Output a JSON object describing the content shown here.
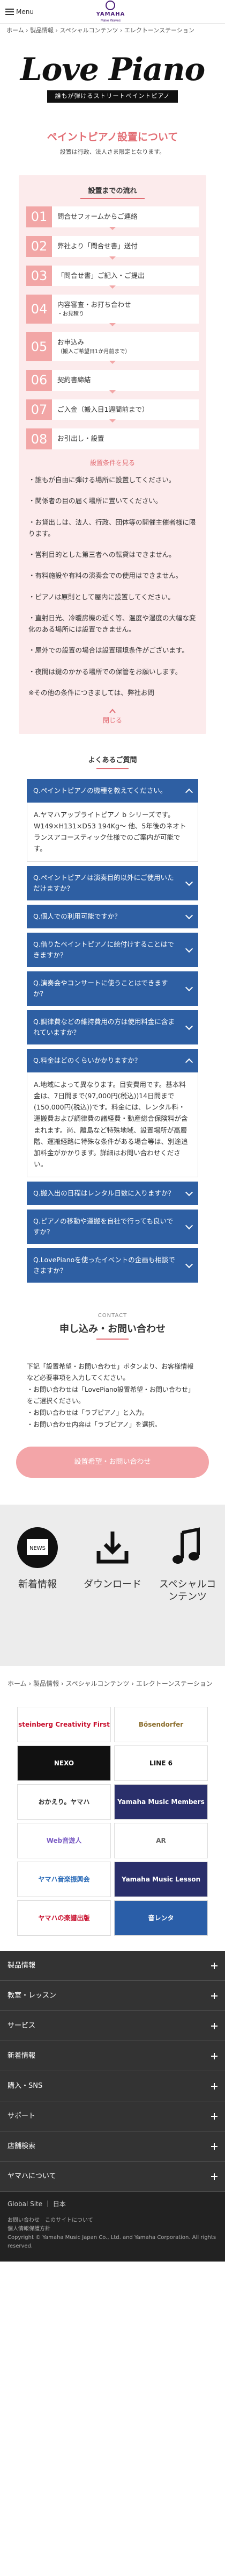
{
  "header": {
    "menu_label": "Menu",
    "brand": "YAMAHA",
    "brand_sub": "Make Waves"
  },
  "breadcrumb": {
    "text": "ホーム › 製品情報 › スペシャルコンテンツ › エレクトーンステーション"
  },
  "hero": {
    "title": "Love Piano",
    "tag": "誰もが弾けるストリートペイントピアノ"
  },
  "section": {
    "title": "ペイントピアノ設置について",
    "sub": "設置は行政、法人さま限定となります。"
  },
  "flow": {
    "heading": "設置までの流れ",
    "steps": [
      {
        "no": "01",
        "text": "問合せフォームからご連絡",
        "note": ""
      },
      {
        "no": "02",
        "text": "弊社より「問合せ書」送付",
        "note": ""
      },
      {
        "no": "03",
        "text": "「問合せ書」ご記入・ご提出",
        "note": ""
      },
      {
        "no": "04",
        "text": "内容審査・お打ち合わせ",
        "note": "・お見積り"
      },
      {
        "no": "05",
        "text": "お申込み",
        "note": "（搬入ご希望日1か月前まで）"
      },
      {
        "no": "06",
        "text": "契約書締結",
        "note": ""
      },
      {
        "no": "07",
        "text": "ご入金（搬入日1週間前まで）",
        "note": ""
      },
      {
        "no": "08",
        "text": "お引出し・設置",
        "note": ""
      }
    ],
    "cond_link": "設置条件を見る",
    "conditions": [
      "・誰もが自由に弾ける場所に設置してください。",
      "・関係者の目の届く場所に置いてください。",
      "・お貸出しは、法人、行政、団体等の開催主催者様に限ります。",
      "・営利目的とした第三者への転貸はできません。",
      "・有料施設や有料の演奏会での使用はできません。",
      "・ピアノは原則として屋内に設置してください。",
      "・直射日光、冷暖房機の近く等、温度や湿度の大幅な変化のある場所には設置できません。",
      "・屋外での設置の場合は設置環境条件がございます。",
      "・夜間は鍵のかかる場所での保管をお願いします。",
      "※その他の条件につきましては、弊社お問"
    ],
    "close_link": "閉じる"
  },
  "faq": {
    "title": "よくあるご質問",
    "items": [
      {
        "q": "Q.ペイントピアノの機種を教えてください。",
        "open": true,
        "a": "A.ヤマハアップライトピアノ b シリーズです。W149×H131×D53 194Kg〜 他、5年後のネオトランスアコースティック仕様でのご案内が可能です。"
      },
      {
        "q": "Q.ペイントピアノは演奏目的以外にご使用いただけますか？",
        "open": false,
        "a": ""
      },
      {
        "q": "Q.個人での利用可能ですか？",
        "open": false,
        "a": ""
      },
      {
        "q": "Q.借りたペイントピアノに絵付けすることはできますか？",
        "open": false,
        "a": ""
      },
      {
        "q": "Q.演奏会やコンサートに使うことはできますか？",
        "open": false,
        "a": ""
      },
      {
        "q": "Q.調律費などの維持費用の方は使用料金に含まれていますか？",
        "open": false,
        "a": ""
      },
      {
        "q": "Q.料金はどのくらいかかりますか？",
        "open": true,
        "a": "A.地域によって異なります。目安費用です。基本料金は、7日間まで(97,000円(税込))14日間まで(150,000円(税込))です。料金には、レンタル料・運搬費および調律費の諸経費・動産総合保険料が含まれます。尚、離島など特殊地域、設置場所が高層階、運搬経路に特殊な条件がある場合等は、別途追加料金がかかります。詳細はお問い合わせください。"
      },
      {
        "q": "Q.搬入出の日程はレンタル日数に入りますか？",
        "open": false,
        "a": ""
      },
      {
        "q": "Q.ピアノの移動や運搬を自社で行っても良いですか？",
        "open": false,
        "a": ""
      },
      {
        "q": "Q.LovePianoを使ったイベントの企画も相談できますか？",
        "open": false,
        "a": ""
      }
    ]
  },
  "contact": {
    "small": "CONTACT",
    "title": "申し込み・お問い合わせ",
    "body": [
      "下記「設置希望・お問い合わせ」ボタンより、お客様情報など必要事項を入力してください。",
      "・お問い合わせは「LovePiano設置希望・お問い合わせ」をご選択ください。",
      "・お問い合わせは「ラブピアノ」と入力。",
      "・お問い合わせ内容は「ラブピアノ」を選択。"
    ],
    "button": "設置希望・お問い合わせ"
  },
  "icons": [
    {
      "name": "news",
      "label": "新着情報"
    },
    {
      "name": "download",
      "label": "ダウンロード"
    },
    {
      "name": "special",
      "label": "スペシャルコンテンツ"
    }
  ],
  "breadcrumb2": {
    "text": "ホーム › 製品情報 › スペシャルコンテンツ › エレクトーンステーション"
  },
  "banners": [
    {
      "label": "steinberg Creativity First",
      "bg": "#ffffff",
      "fg": "#c8102e"
    },
    {
      "label": "Bösendorfer",
      "bg": "#ffffff",
      "fg": "#8b6d2c"
    },
    {
      "label": "NEXO",
      "bg": "#111111",
      "fg": "#ffffff"
    },
    {
      "label": "LINE 6",
      "bg": "#ffffff",
      "fg": "#111111"
    },
    {
      "label": "おかえり。ヤマハ",
      "bg": "#ffffff",
      "fg": "#333333"
    },
    {
      "label": "Yamaha Music Members",
      "bg": "#2a2f6b",
      "fg": "#ffffff"
    },
    {
      "label": "Web音遊人",
      "bg": "#ffffff",
      "fg": "#7a5cc4"
    },
    {
      "label": "AR",
      "bg": "#ffffff",
      "fg": "#666666"
    },
    {
      "label": "ヤマハ音楽振興会",
      "bg": "#ffffff",
      "fg": "#2a6bb8"
    },
    {
      "label": "Yamaha Music Lesson",
      "bg": "#2a2f6b",
      "fg": "#ffffff"
    },
    {
      "label": "ヤマハの楽譜出版",
      "bg": "#ffffff",
      "fg": "#c8102e"
    },
    {
      "label": "音レンタ",
      "bg": "#2a5ea8",
      "fg": "#ffffff"
    }
  ],
  "footer_nav": [
    "製品情報",
    "教室・レッスン",
    "サービス",
    "新着情報",
    "購入・SNS",
    "サポート",
    "店舗検索",
    "ヤマハについて"
  ],
  "global": {
    "label": "Global Site",
    "lang": "日本"
  },
  "legal": {
    "links": "お問い合わせ　このサイトについて",
    "privacy": "個人情報保護方針",
    "copyright": "Copyright © Yamaha Music Japan Co., Ltd. and Yamaha Corporation. All rights reserved."
  }
}
